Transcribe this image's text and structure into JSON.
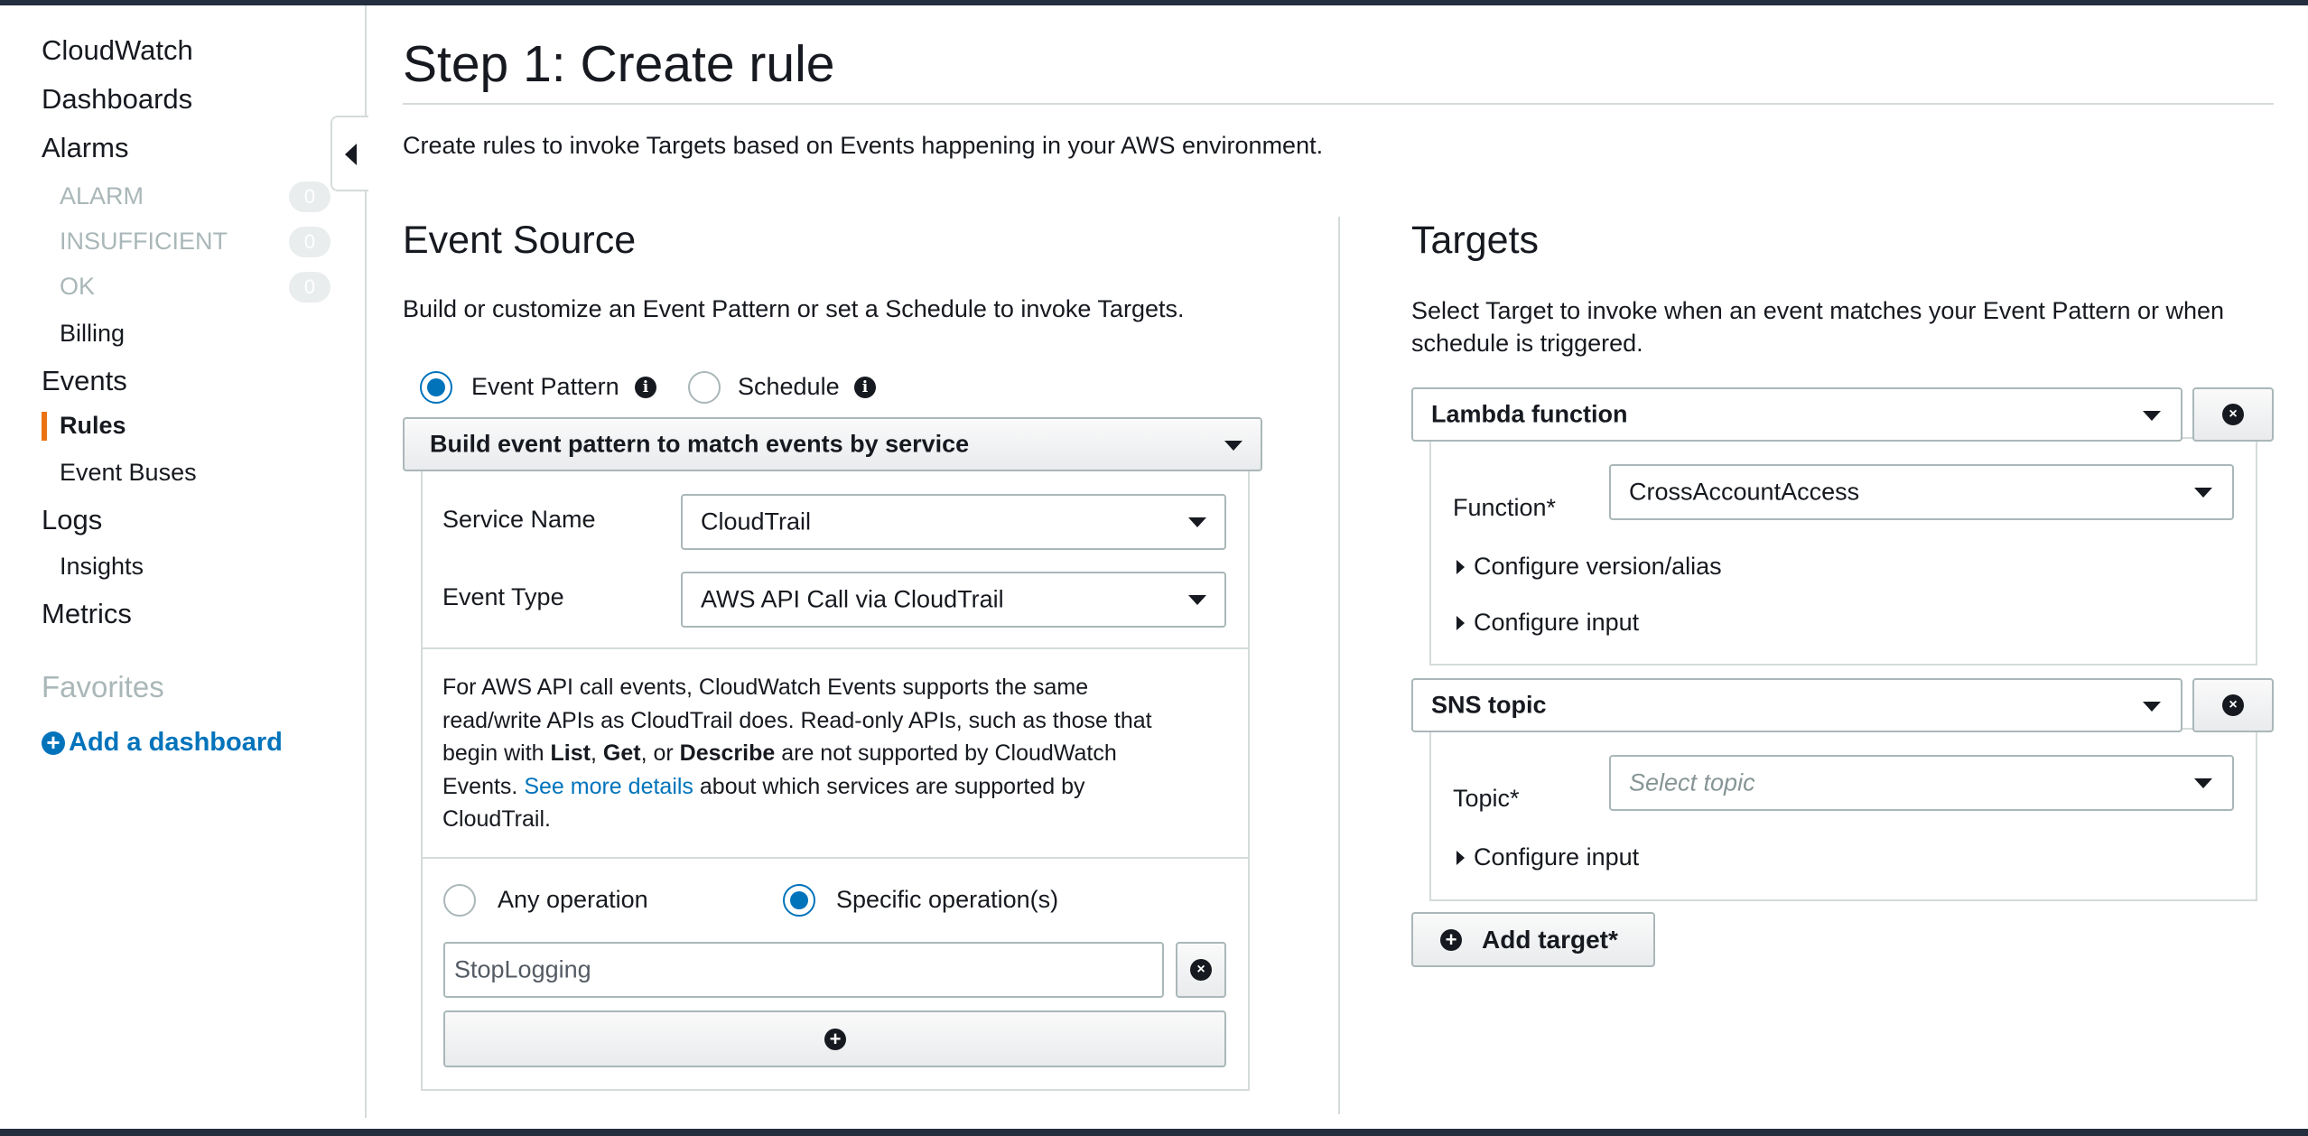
{
  "sidebar": {
    "cloudwatch": "CloudWatch",
    "dashboards": "Dashboards",
    "alarms": "Alarms",
    "alarm_states": [
      {
        "label": "ALARM",
        "count": "0"
      },
      {
        "label": "INSUFFICIENT",
        "count": "0"
      },
      {
        "label": "OK",
        "count": "0"
      }
    ],
    "billing": "Billing",
    "events": "Events",
    "rules": "Rules",
    "event_buses": "Event Buses",
    "logs": "Logs",
    "insights": "Insights",
    "metrics": "Metrics",
    "favorites": "Favorites",
    "add_dashboard": "Add a dashboard"
  },
  "page": {
    "title": "Step 1: Create rule",
    "intro": "Create rules to invoke Targets based on Events happening in your AWS environment."
  },
  "event_source": {
    "heading": "Event Source",
    "description": "Build or customize an Event Pattern or set a Schedule to invoke Targets.",
    "mode_event_pattern": "Event Pattern",
    "mode_schedule": "Schedule",
    "builder_label": "Build event pattern to match events by service",
    "service_name_label": "Service Name",
    "service_name_value": "CloudTrail",
    "event_type_label": "Event Type",
    "event_type_value": "AWS API Call via CloudTrail",
    "note_1": "For AWS API call events, CloudWatch Events supports the same",
    "note_2": "read/write APIs as CloudTrail does. Read-only APIs, such as those that",
    "note_3_pre": "begin with ",
    "note_3_list": "List",
    "note_3_sep1": ", ",
    "note_3_get": "Get",
    "note_3_sep2": ", or ",
    "note_3_describe": "Describe",
    "note_3_post": " are not supported by CloudWatch",
    "note_4_pre": "Events. ",
    "note_4_link": "See more details",
    "note_4_post": " about which services are supported by",
    "note_5": "CloudTrail.",
    "any_operation": "Any operation",
    "specific_operations": "Specific operation(s)",
    "operation_value": "StopLogging"
  },
  "targets": {
    "heading": "Targets",
    "description_1": "Select Target to invoke when an event matches your Event Pattern or when",
    "description_2": "schedule is triggered.",
    "lambda_label": "Lambda function",
    "function_label": "Function*",
    "function_value": "CrossAccountAccess",
    "configure_version": "Configure version/alias",
    "configure_input_1": "Configure input",
    "sns_label": "SNS topic",
    "topic_label": "Topic*",
    "topic_placeholder": "Select topic",
    "configure_input_2": "Configure input",
    "add_target": "Add target*"
  },
  "colors": {
    "accent": "#0073bb",
    "active_marker": "#ec7211",
    "header_bar": "#232f3e"
  }
}
